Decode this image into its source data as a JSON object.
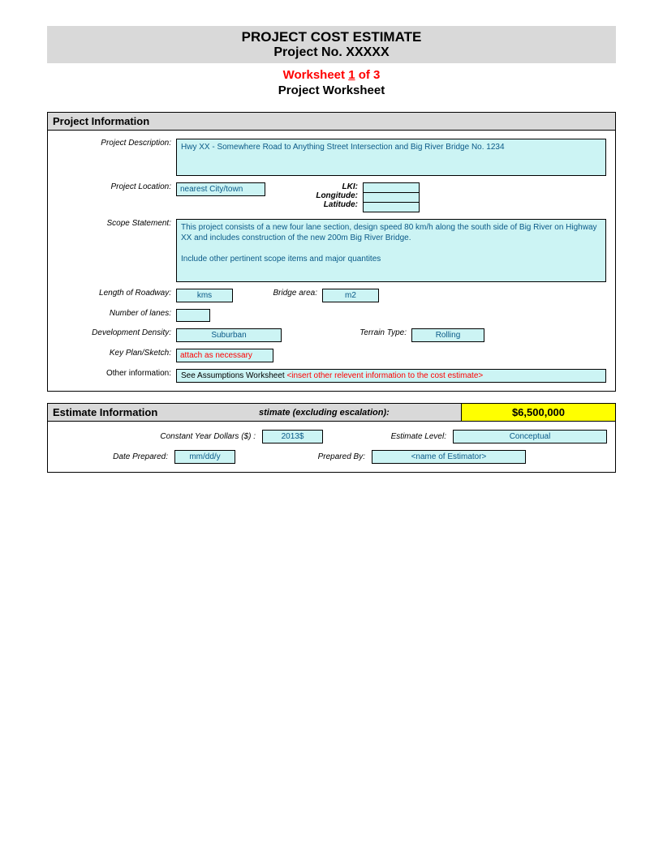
{
  "title": {
    "main": "PROJECT COST ESTIMATE",
    "sub": "Project No. XXXXX",
    "worksheet_prefix": "Worksheet ",
    "worksheet_num": "1",
    "worksheet_suffix": " of 3",
    "worksheet_name": "Project Worksheet"
  },
  "project_info": {
    "header": "Project Information",
    "labels": {
      "description": "Project Description:",
      "location": "Project Location:",
      "lki": "LKI:",
      "longitude": "Longitude:",
      "latitude": "Latitude:",
      "scope": "Scope Statement:",
      "length": "Length of Roadway:",
      "bridge_area": "Bridge area:",
      "lanes": "Number of lanes:",
      "density": "Development Density:",
      "terrain": "Terrain Type:",
      "keyplan": "Key Plan/Sketch:",
      "other": "Other information:"
    },
    "values": {
      "description": "Hwy XX - Somewhere Road to Anything Street Intersection and Big River Bridge No. 1234",
      "location": "nearest City/town",
      "lki": "",
      "longitude": "",
      "latitude": "",
      "scope": "This project consists of a new four lane section, design speed 80 km/h along the south side of Big River on Highway XX and includes construction of the new 200m Big River Bridge.\n\nInclude other pertinent scope items and major quantites",
      "length": "kms",
      "bridge_area": "m2",
      "lanes": "",
      "density": "Suburban",
      "terrain": "Rolling",
      "keyplan": "attach as necessary",
      "other_prefix": "See Assumptions Worksheet ",
      "other_insert": "<insert other relevent information to the cost estimate>"
    }
  },
  "estimate_info": {
    "header": "Estimate Information",
    "total_label": "stimate (excluding escalation):",
    "total_value": "$6,500,000",
    "labels": {
      "constant_year": "Constant Year Dollars ($) :",
      "estimate_level": "Estimate Level:",
      "date_prepared": "Date Prepared:",
      "prepared_by": "Prepared By:"
    },
    "values": {
      "constant_year": "2013$",
      "estimate_level": "Conceptual",
      "date_prepared": "mm/dd/y",
      "prepared_by": "<name of Estimator>"
    }
  }
}
